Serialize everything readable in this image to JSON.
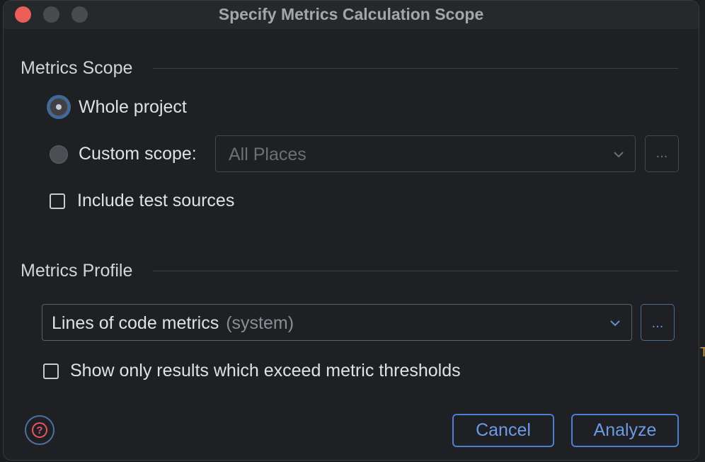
{
  "window": {
    "title": "Specify Metrics Calculation Scope"
  },
  "scope": {
    "section_title": "Metrics Scope",
    "whole_project_label": "Whole project",
    "whole_project_selected": true,
    "custom_scope_label": "Custom scope:",
    "custom_scope_selected": false,
    "custom_scope_value": "All Places",
    "custom_scope_browse": "...",
    "include_tests_label": "Include test sources",
    "include_tests_checked": false
  },
  "profile": {
    "section_title": "Metrics Profile",
    "selected_name": "Lines of code metrics",
    "selected_suffix": "(system)",
    "browse_label": "...",
    "show_exceeding_label": "Show only results which exceed metric thresholds",
    "show_exceeding_checked": false
  },
  "footer": {
    "help_glyph": "?",
    "cancel_label": "Cancel",
    "analyze_label": "Analyze"
  },
  "background_hint": "T",
  "colors": {
    "accent": "#4c7ed1",
    "close_button": "#ec5f59",
    "help_icon": "#ea5366"
  }
}
